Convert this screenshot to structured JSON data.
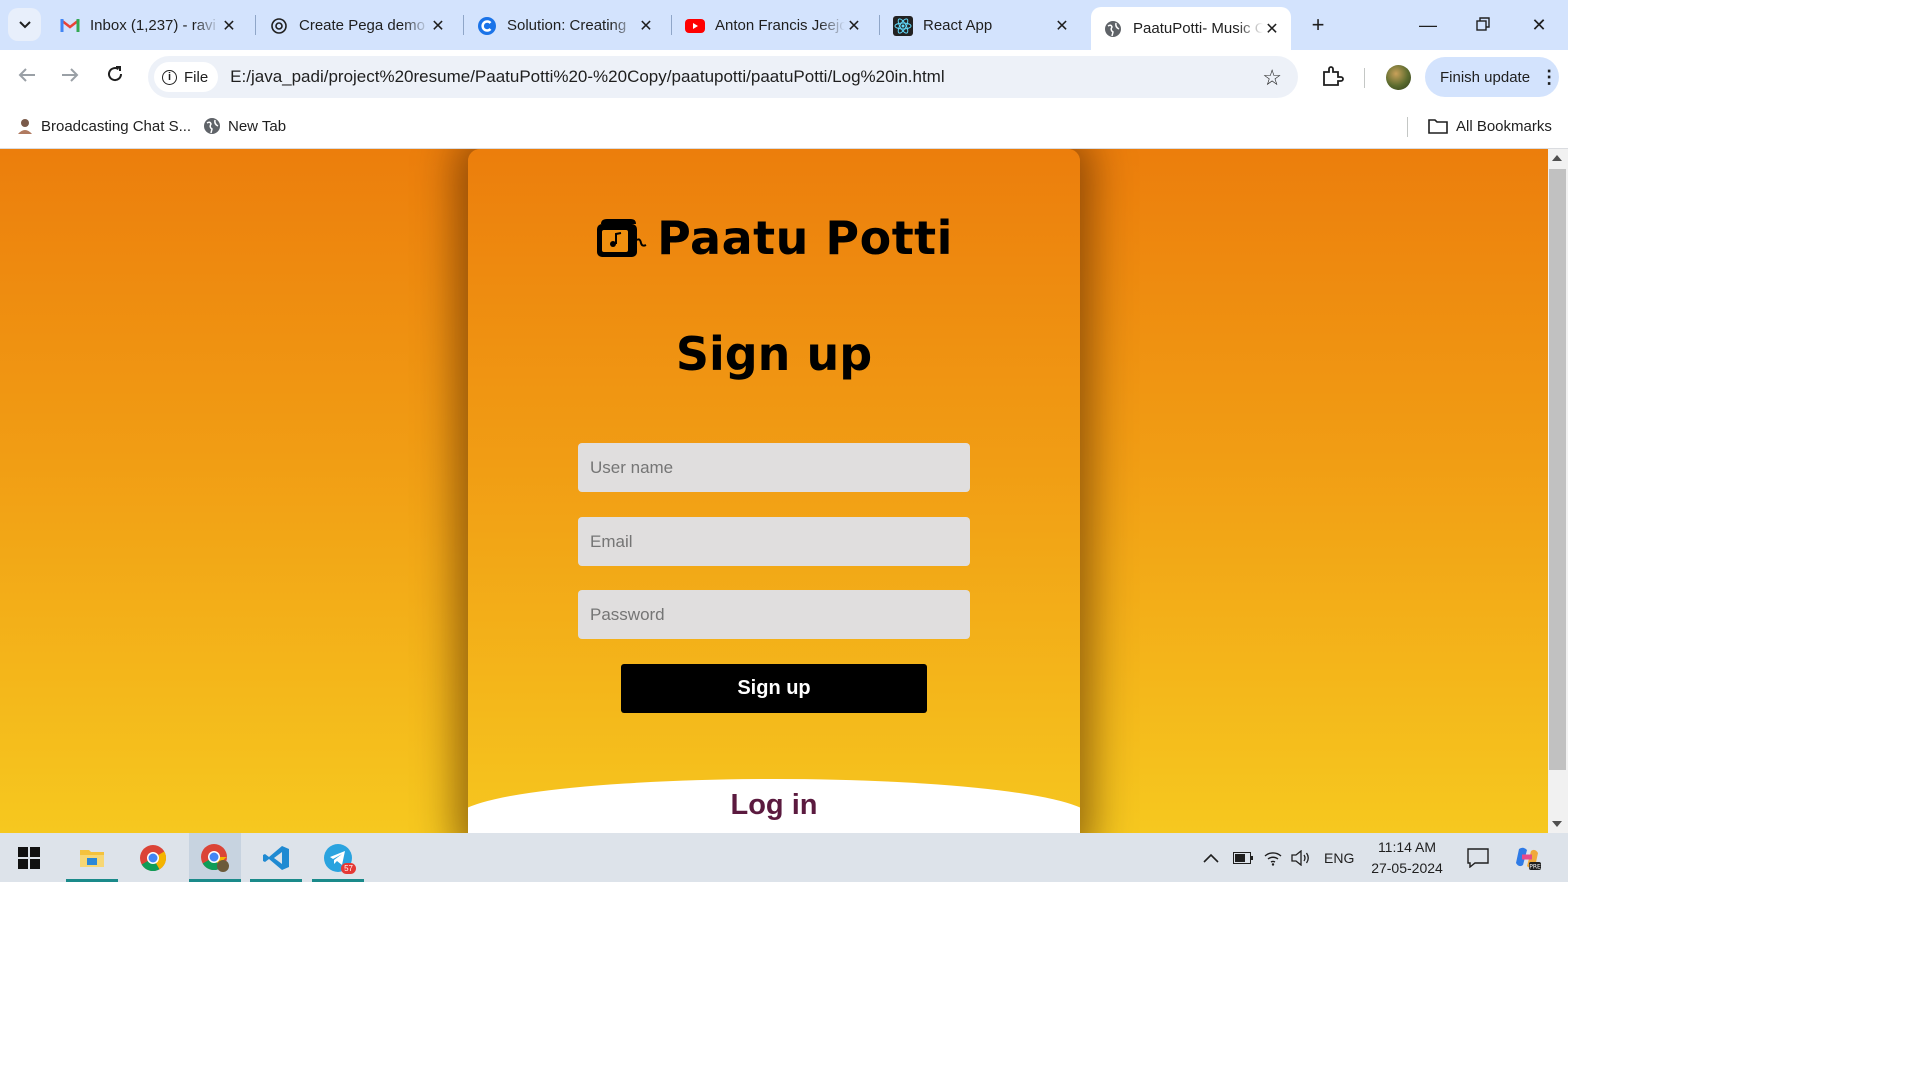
{
  "browser": {
    "tabs": [
      {
        "label": "Inbox (1,237) - ravi",
        "icon": "gmail-icon",
        "active": false
      },
      {
        "label": "Create Pega demo",
        "icon": "openai-icon",
        "active": false
      },
      {
        "label": "Solution: Creating",
        "icon": "chegg-icon",
        "active": false
      },
      {
        "label": "Anton Francis Jeejo",
        "icon": "youtube-icon",
        "active": false
      },
      {
        "label": "React App",
        "icon": "react-icon",
        "active": false
      },
      {
        "label": "PaatuPotti- Music Collection",
        "icon": "globe-icon",
        "active": true
      }
    ],
    "omnibox": {
      "chip_label": "File",
      "url": "E:/java_padi/project%20resume/PaatuPotti%20-%20Copy/paatupotti/paatuPotti/Log%20in.html"
    },
    "finish_update_label": "Finish update",
    "bookmarks": [
      {
        "label": "Broadcasting Chat S...",
        "icon": "avatar-icon"
      },
      {
        "label": "New Tab",
        "icon": "globe-icon"
      }
    ],
    "all_bookmarks_label": "All Bookmarks"
  },
  "page": {
    "brand_name": "Paatu Potti",
    "form_title": "Sign up",
    "fields": {
      "username_placeholder": "User name",
      "email_placeholder": "Email",
      "password_placeholder": "Password"
    },
    "submit_label": "Sign up",
    "login_label": "Log in",
    "colors": {
      "gradient_top": "#ec7e0c",
      "gradient_bottom": "#f6c81f",
      "input_bg": "#e0dede",
      "button_bg": "#000000",
      "login_text": "#5b1a3f"
    }
  },
  "taskbar": {
    "apps": [
      "start-icon",
      "file-explorer-icon",
      "chrome-icon",
      "chrome-profile-icon",
      "vscode-icon",
      "telegram-icon"
    ],
    "telegram_badge": "57",
    "language": "ENG",
    "time": "11:14 AM",
    "date": "27-05-2024"
  }
}
